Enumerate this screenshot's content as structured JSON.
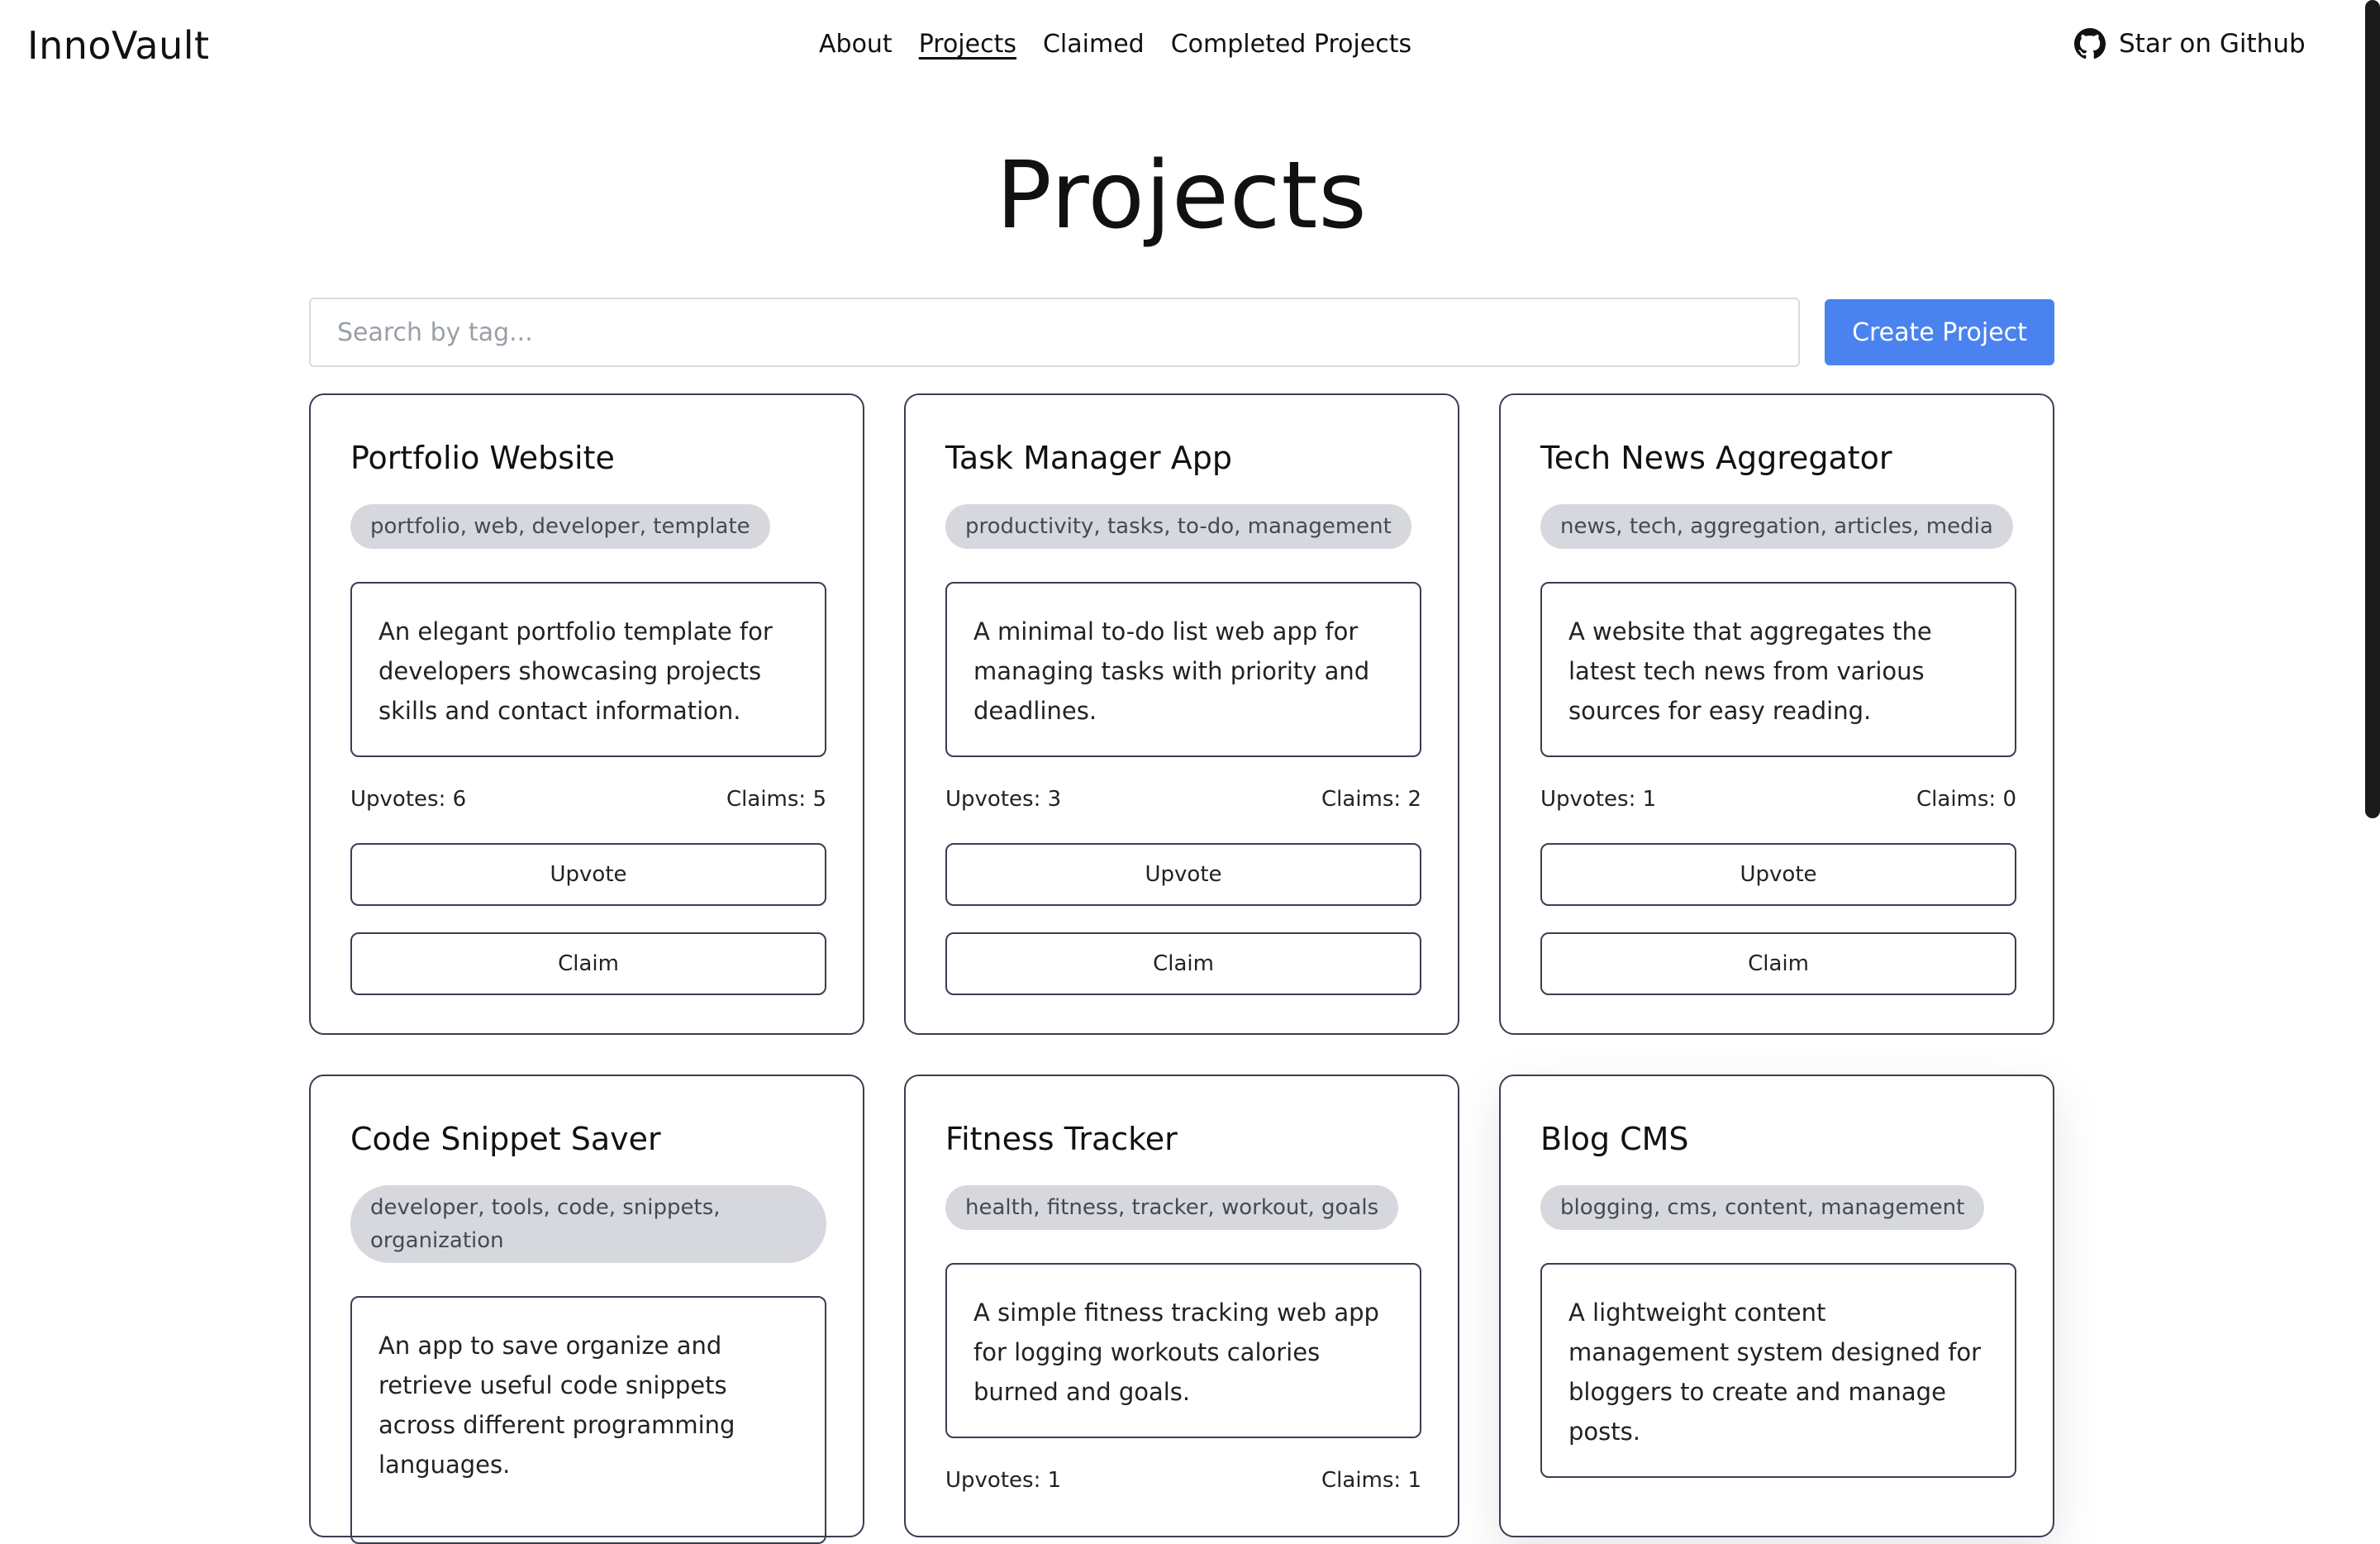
{
  "app": {
    "brand": "InnoVault"
  },
  "nav": {
    "links": [
      "About",
      "Projects",
      "Claimed",
      "Completed Projects"
    ],
    "active": "Projects",
    "github_label": "Star on Github"
  },
  "page": {
    "title": "Projects",
    "search_placeholder": "Search by tag...",
    "create_label": "Create Project"
  },
  "labels": {
    "upvotes": "Upvotes:",
    "claims": "Claims:",
    "upvote_button": "Upvote",
    "claim_button": "Claim"
  },
  "projects": [
    {
      "title": "Portfolio Website",
      "tags": "portfolio, web, developer, template",
      "description": "An elegant portfolio template for developers showcasing projects skills and contact information.",
      "upvotes": "6",
      "claims": "5"
    },
    {
      "title": "Task Manager App",
      "tags": "productivity, tasks, to-do, management",
      "description": "A minimal to-do list web app for managing tasks with priority and deadlines.",
      "upvotes": "3",
      "claims": "2"
    },
    {
      "title": "Tech News Aggregator",
      "tags": "news, tech, aggregation, articles, media",
      "description": "A website that aggregates the latest tech news from various sources for easy reading.",
      "upvotes": "1",
      "claims": "0"
    },
    {
      "title": "Code Snippet Saver",
      "tags": "developer, tools, code, snippets, organization",
      "description": "An app to save organize and retrieve useful code snippets across different programming languages."
    },
    {
      "title": "Fitness Tracker",
      "tags": "health, fitness, tracker, workout, goals",
      "description": "A simple fitness tracking web app for logging workouts calories burned and goals.",
      "upvotes": "1",
      "claims": "1"
    },
    {
      "title": "Blog CMS",
      "tags": "blogging, cms, content, management",
      "description": "A lightweight content management system designed for bloggers to create and manage posts."
    }
  ]
}
